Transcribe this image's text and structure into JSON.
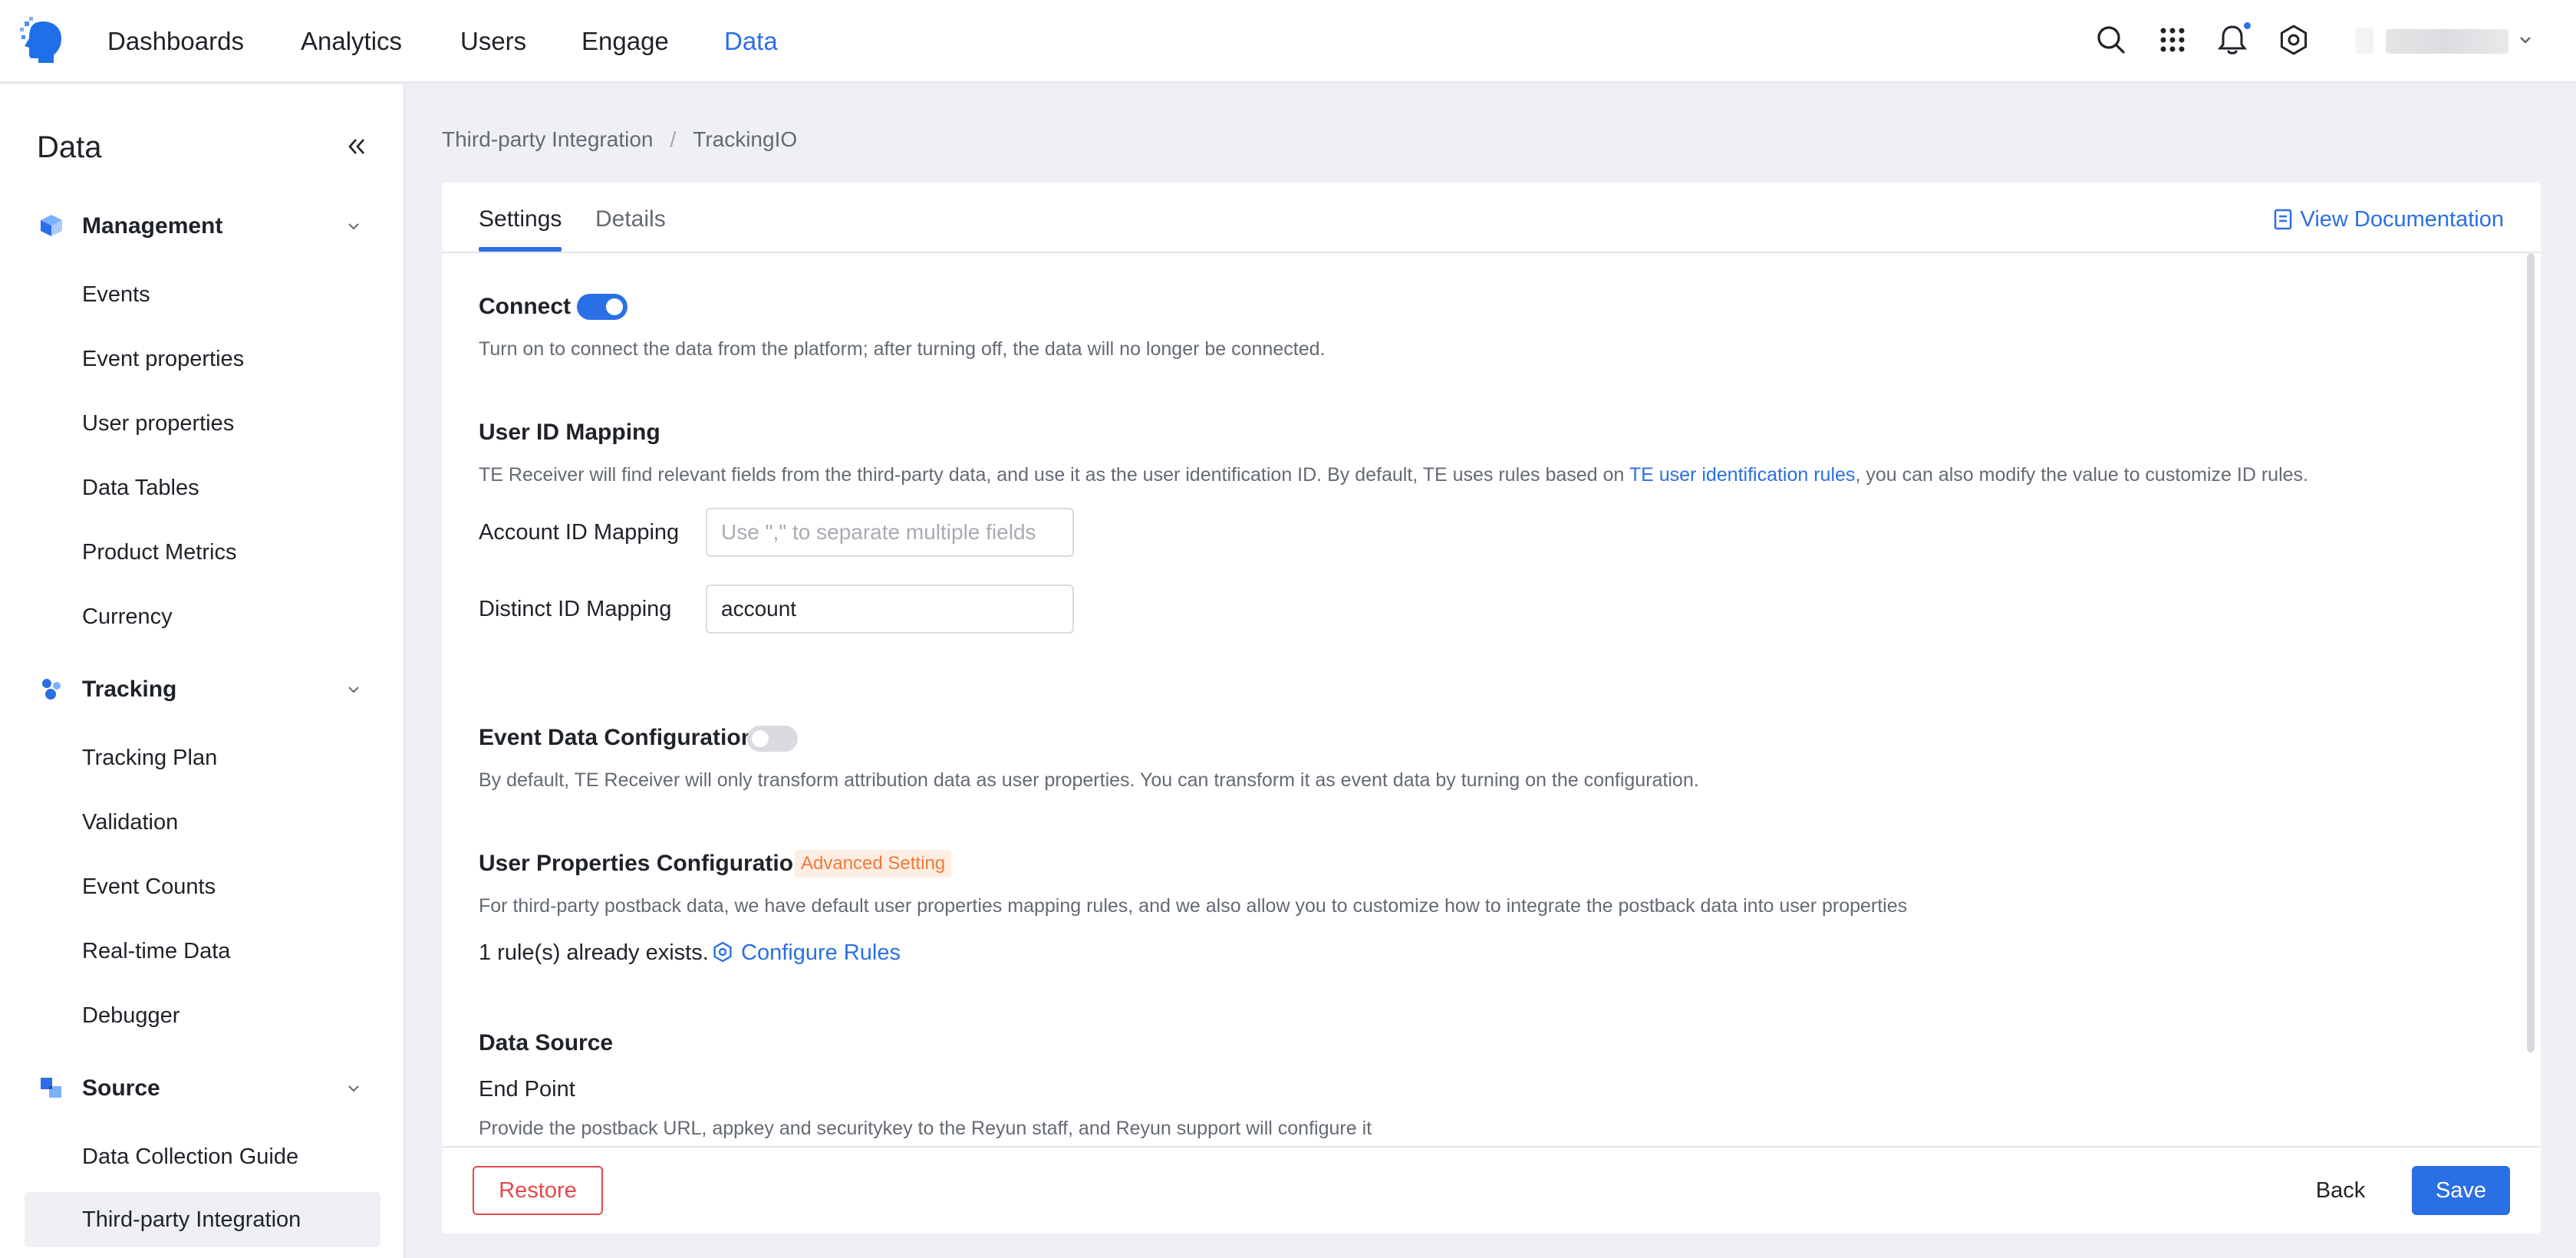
{
  "topnav": {
    "items": [
      {
        "label": "Dashboards",
        "active": false
      },
      {
        "label": "Analytics",
        "active": false
      },
      {
        "label": "Users",
        "active": false
      },
      {
        "label": "Engage",
        "active": false
      },
      {
        "label": "Data",
        "active": true
      }
    ],
    "icons": [
      "search-icon",
      "apps-grid-icon",
      "bell-icon",
      "gear-icon",
      "chevron-down-icon"
    ],
    "accent_color": "#2b6fe6",
    "has_notification": true
  },
  "sidebar": {
    "title": "Data",
    "groups": [
      {
        "label": "Management",
        "icon": "cube-icon",
        "items": [
          "Events",
          "Event properties",
          "User properties",
          "Data Tables",
          "Product Metrics",
          "Currency"
        ]
      },
      {
        "label": "Tracking",
        "icon": "tracking-icon",
        "items": [
          "Tracking Plan",
          "Validation",
          "Event Counts",
          "Real-time Data",
          "Debugger"
        ]
      },
      {
        "label": "Source",
        "icon": "source-icon",
        "items": [
          "Data Collection Guide",
          "Third-party Integration"
        ]
      }
    ],
    "active_item": "Third-party Integration"
  },
  "breadcrumb": {
    "parent": "Third-party Integration",
    "separator": "/",
    "current": "TrackingIO"
  },
  "tabs": [
    {
      "label": "Settings",
      "active": true
    },
    {
      "label": "Details",
      "active": false
    }
  ],
  "doc_link": "View Documentation",
  "connect": {
    "label": "Connect",
    "enabled": true,
    "description": "Turn on to connect the data from the platform; after turning off, the data will no longer be connected."
  },
  "user_id_mapping": {
    "title": "User ID Mapping",
    "description_before": "TE Receiver will find relevant fields from the third-party data, and use it as the user identification ID. By default, TE uses rules based on ",
    "description_link": "TE user identification rules",
    "description_after": ", you can also modify the value to customize ID rules.",
    "account_label": "Account ID Mapping",
    "account_value": "",
    "account_placeholder": "Use \",\" to separate multiple fields",
    "distinct_label": "Distinct ID Mapping",
    "distinct_value": "account"
  },
  "event_data_config": {
    "label": "Event Data Configuration",
    "enabled": false,
    "description": "By default, TE Receiver will only transform attribution data as user properties. You can transform it as event data by turning on the configuration."
  },
  "user_props_config": {
    "title": "User Properties Configuration",
    "badge": "Advanced Setting",
    "description": "For third-party postback data, we have default user properties mapping rules, and we also allow you to customize how to integrate the postback data into user properties",
    "rules_text": "1 rule(s) already exists.",
    "configure_link": "Configure Rules"
  },
  "data_source": {
    "title": "Data Source",
    "subtitle": "End Point",
    "description": "Provide the postback URL, appkey and securitykey to the Reyun staff, and Reyun support will configure it"
  },
  "footer": {
    "restore": "Restore",
    "back": "Back",
    "save": "Save"
  }
}
